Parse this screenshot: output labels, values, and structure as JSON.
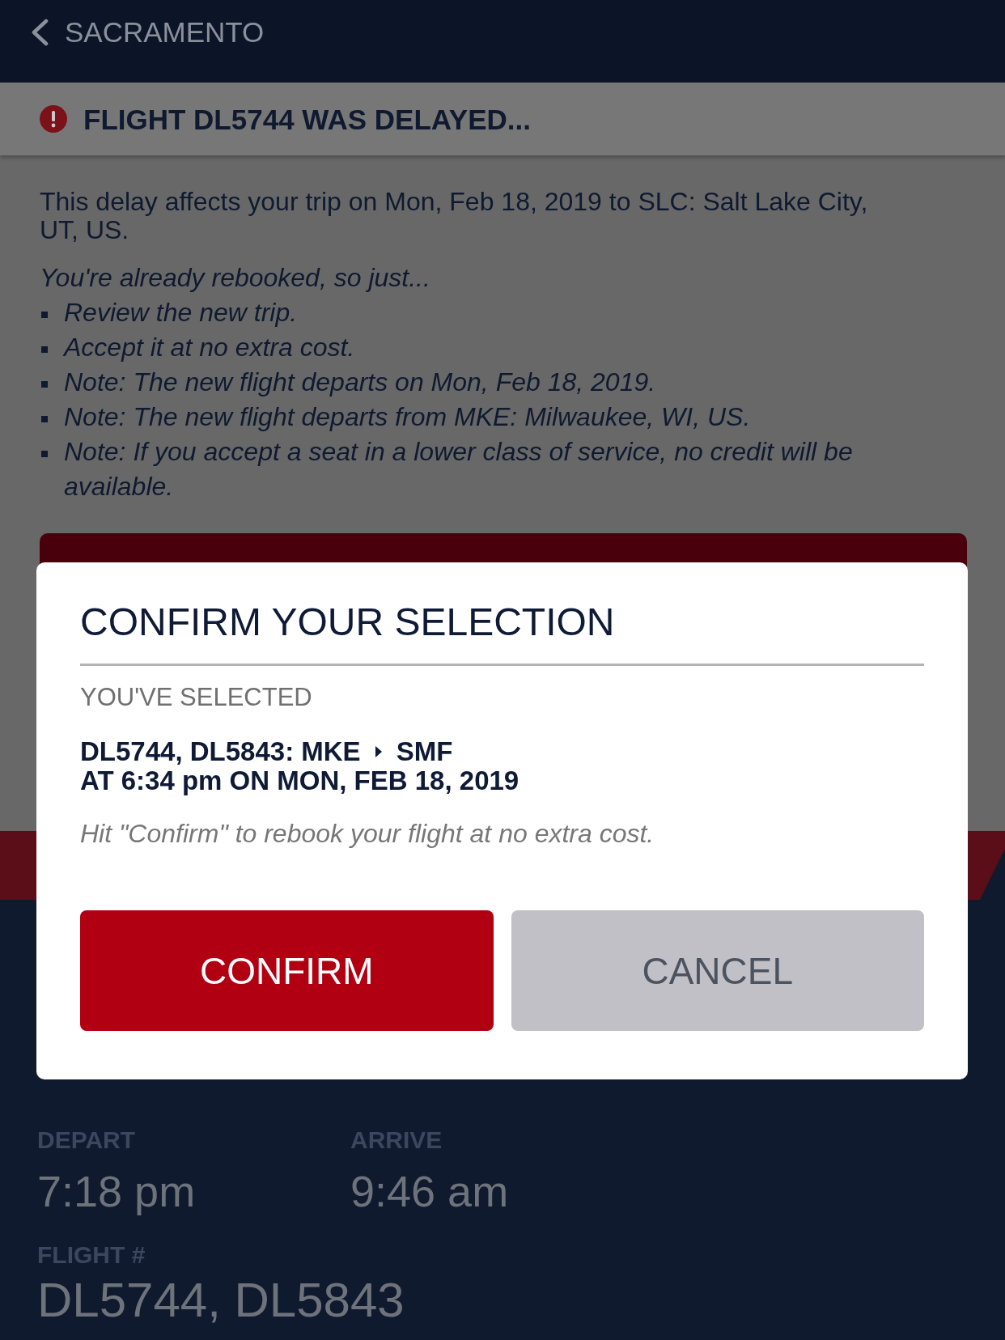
{
  "header": {
    "back_label": "SACRAMENTO"
  },
  "alert": {
    "title": "FLIGHT DL5744 WAS DELAYED..."
  },
  "message": {
    "intro": "This delay affects your trip on Mon, Feb 18, 2019 to SLC: Salt Lake City, UT, US.",
    "lead": "You're already rebooked, so just...",
    "steps": [
      "Review the new trip.",
      "Accept it at no extra cost.",
      "Note: The new flight departs on Mon, Feb 18, 2019.",
      "Note: The new flight departs from MKE: Milwaukee, WI, US.",
      "Note: If you accept a seat in a lower class of service, no credit will be available."
    ]
  },
  "dialog": {
    "title": "CONFIRM YOUR SELECTION",
    "subtitle": "YOU'VE SELECTED",
    "selection": {
      "route_from": "DL5744, DL5843: MKE",
      "route_to": "SMF",
      "time_line": "AT 6:34 pm ON MON, FEB 18, 2019"
    },
    "hint": "Hit \"Confirm\" to rebook your flight at no extra cost.",
    "buttons": [
      {
        "label": "CONFIRM",
        "kind": "primary"
      },
      {
        "label": "CANCEL",
        "kind": "secondary"
      }
    ]
  },
  "details": {
    "times": [
      {
        "label": "DEPART",
        "value": "7:18 pm"
      },
      {
        "label": "ARRIVE",
        "value": "9:46 am"
      }
    ],
    "flight": {
      "label": "FLIGHT #",
      "value": "DL5744, DL5843"
    }
  }
}
